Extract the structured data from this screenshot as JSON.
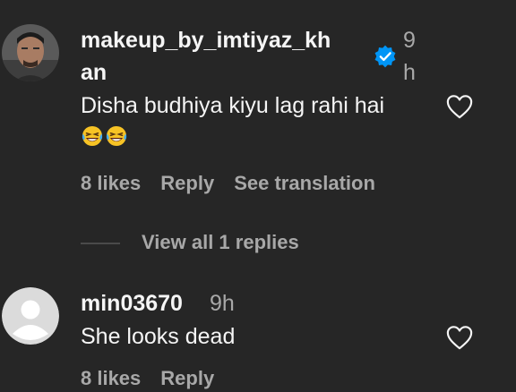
{
  "comments": [
    {
      "username_line1": "makeup_by_imtiyaz_kh",
      "username_line2": "an",
      "time_line1": "9",
      "time_line2": "h",
      "verified": true,
      "text_line1": "Disha budhiya kiyu lag rahi hai",
      "emoji": "😂😂",
      "likes": "8 likes",
      "reply": "Reply",
      "translate": "See translation",
      "view_replies": "View all 1 replies"
    },
    {
      "username": "min03670",
      "time": "9h",
      "text": "She looks dead",
      "likes": "8 likes",
      "reply": "Reply"
    }
  ],
  "colors": {
    "background": "#262626",
    "primary_text": "#f5f5f5",
    "secondary_text": "#a8a8a8",
    "verified_blue": "#0095f6"
  }
}
